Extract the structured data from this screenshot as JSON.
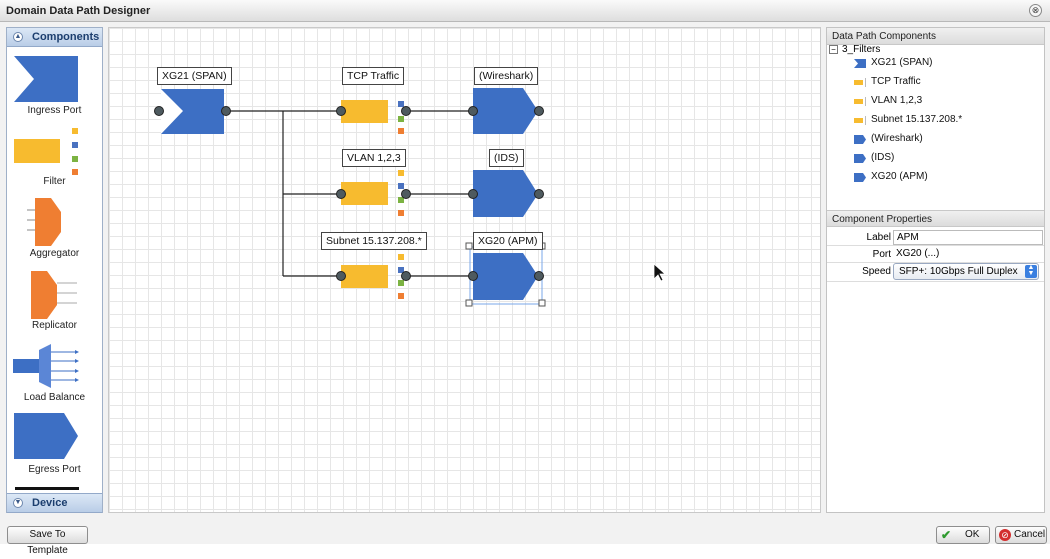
{
  "window": {
    "title": "Domain Data Path Designer",
    "close_glyph": "⊗"
  },
  "palette": {
    "header_components": "Components",
    "header_device": "Device",
    "items": [
      {
        "label": "Ingress Port",
        "icon": "ingress-port-icon"
      },
      {
        "label": "Filter",
        "icon": "filter-icon"
      },
      {
        "label": "Aggregator",
        "icon": "aggregator-icon"
      },
      {
        "label": "Replicator",
        "icon": "replicator-icon"
      },
      {
        "label": "Load Balance",
        "icon": "load-balance-icon"
      },
      {
        "label": "Egress Port",
        "icon": "egress-port-icon"
      }
    ]
  },
  "canvas": {
    "nodes": [
      {
        "label": "XG21 (SPAN)",
        "type": "ingress"
      },
      {
        "label": "TCP Traffic",
        "type": "filter"
      },
      {
        "label": "VLAN 1,2,3",
        "type": "filter"
      },
      {
        "label": "Subnet 15.137.208.*",
        "type": "filter"
      },
      {
        "label": "(Wireshark)",
        "type": "egress"
      },
      {
        "label": "(IDS)",
        "type": "egress"
      },
      {
        "label": "XG20 (APM)",
        "type": "egress",
        "selected": true
      }
    ],
    "colors": {
      "ingress": "#3d6fc4",
      "filter": "#f7bb2f",
      "egress": "#3d6fc4",
      "aggregator": "#ef7e32",
      "green": "#7cb342",
      "orange": "#ef7e32",
      "blue": "#4a72c0",
      "yellow": "#f7bb2f"
    }
  },
  "components_panel": {
    "title": "Data Path Components",
    "root": "3_Filters",
    "items": [
      {
        "label": "XG21 (SPAN)",
        "icon": "ingress-icon"
      },
      {
        "label": "TCP Traffic",
        "icon": "filter-icon"
      },
      {
        "label": "VLAN 1,2,3",
        "icon": "filter-icon"
      },
      {
        "label": "Subnet 15.137.208.*",
        "icon": "filter-icon"
      },
      {
        "label": "(Wireshark)",
        "icon": "egress-icon"
      },
      {
        "label": "(IDS)",
        "icon": "egress-icon"
      },
      {
        "label": "XG20 (APM)",
        "icon": "egress-icon"
      }
    ]
  },
  "properties_panel": {
    "title": "Component Properties",
    "label_key": "Label",
    "label_value": "APM",
    "port_key": "Port",
    "port_value": "XG20 (...)",
    "speed_key": "Speed",
    "speed_value": "SFP+: 10Gbps Full Duplex"
  },
  "footer": {
    "save_template": "Save To Template",
    "ok": "OK",
    "cancel": "Cancel"
  }
}
